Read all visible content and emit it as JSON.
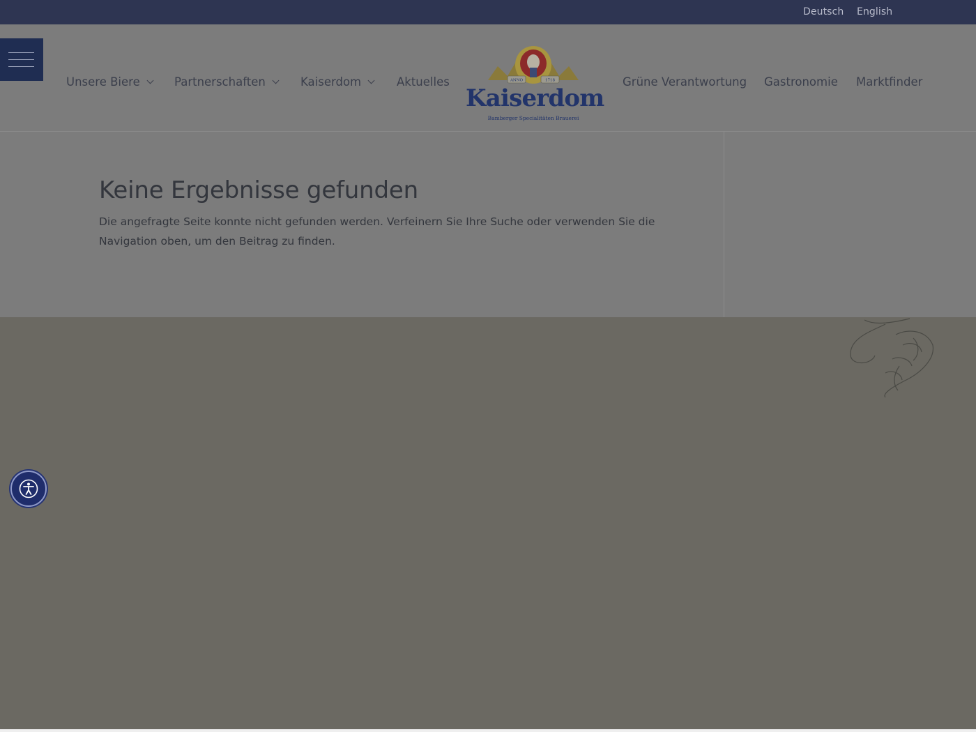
{
  "top_bar": {
    "languages": [
      "Deutsch",
      "English"
    ]
  },
  "header": {
    "menu_button_label": "",
    "nav_left": [
      {
        "label": "Unsere Biere",
        "has_dropdown": true
      },
      {
        "label": "Partnerschaften",
        "has_dropdown": true
      },
      {
        "label": "Kaiserdom",
        "has_dropdown": true
      },
      {
        "label": "Aktuelles",
        "has_dropdown": false
      }
    ],
    "nav_right": [
      {
        "label": "Grüne Verantwortung",
        "has_dropdown": false
      },
      {
        "label": "Gastronomie",
        "has_dropdown": false
      },
      {
        "label": "Marktfinder",
        "has_dropdown": false
      }
    ],
    "logo": {
      "wordmark": "Kaiserdom",
      "tagline": "Bamberger Specialitäten Brauerei",
      "anno": "ANNO",
      "year": "1718"
    }
  },
  "main": {
    "title": "Keine Ergebnisse gefunden",
    "message": "Die angefragte Seite konnte nicht gefunden werden. Verfeinern Sie Ihre Suche oder verwenden Sie die Navigation oben, um den Beitrag zu finden."
  },
  "accessibility": {
    "icon": "accessibility-icon"
  },
  "colors": {
    "top_bar": "#2e3552",
    "menu_button": "#1f2d52",
    "brand_navy": "#22346a",
    "overlay_gray": "#7c7c7c"
  }
}
